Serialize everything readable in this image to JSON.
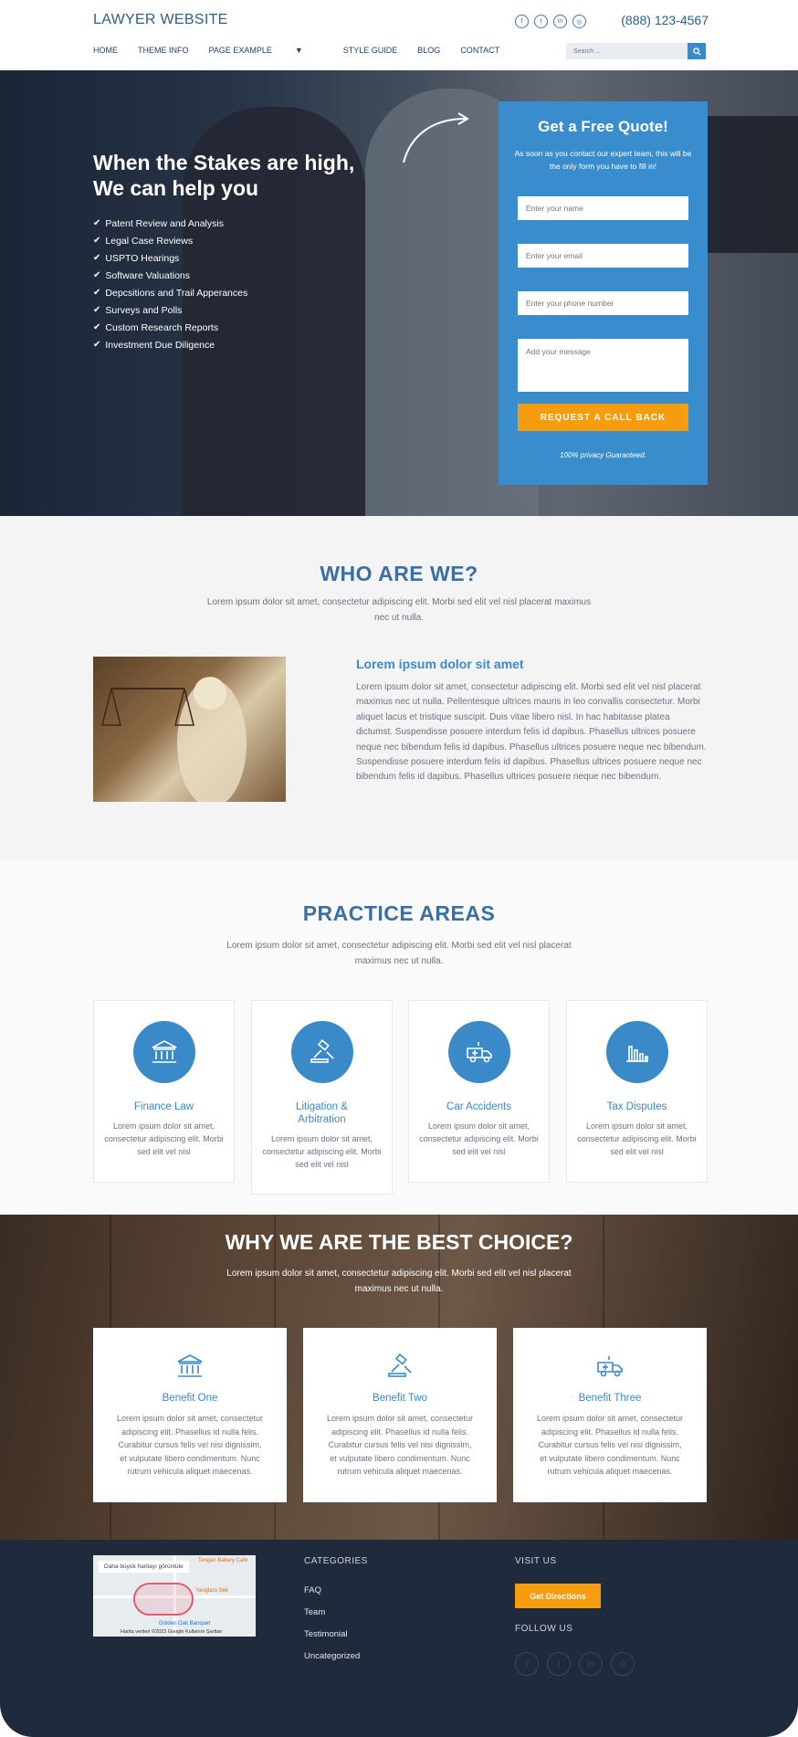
{
  "header": {
    "brand": "LAWYER WEBSITE",
    "phone": "(888) 123-4567",
    "social": [
      "facebook-icon",
      "twitter-icon",
      "linkedin-icon",
      "instagram-icon"
    ],
    "nav": [
      "HOME",
      "THEME INFO",
      "PAGE EXAMPLE",
      "STYLE GUIDE",
      "BLOG",
      "CONTACT"
    ],
    "search_placeholder": "Search ..."
  },
  "hero": {
    "title": "When the Stakes are high, We can help you",
    "list": [
      "Patent Review and Analysis",
      "Legal Case Reviews",
      "USPTO Hearings",
      "Software Valuations",
      "Depcsitions and Trail Apperances",
      "Surveys and Polls",
      "Custom Research Reports",
      "Investment Due Diligence"
    ],
    "form": {
      "title": "Get a Free Quote!",
      "subtitle": "As soon as you contact our expert team, this will be the only form you have to fill in!",
      "name_placeholder": "Enter your name",
      "email_placeholder": "Enter your email",
      "phone_placeholder": "Enter your phone number",
      "message_placeholder": "Add your message",
      "button": "REQUEST A CALL BACK",
      "privacy": "100% privacy Guaranteed."
    }
  },
  "who": {
    "title": "WHO ARE WE?",
    "subtitle": "Lorem ipsum dolor sit amet, consectetur adipiscing elit. Morbi sed elit vel nisl placerat maximus nec ut nulla.",
    "heading": "Lorem ipsum dolor sit amet",
    "body": "Lorem ipsum dolor sit amet, consectetur adipiscing elit. Morbi sed elit vel nisl placerat maximus nec ut nulla. Pellentesque ultrices mauris in leo convallis consectetur. Morbi aliquet lacus et tristique suscipit. Duis vitae libero nisl. In hac habitasse platea dictumst. Suspendisse posuere interdum felis id dapibus. Phasellus ultrices posuere neque nec bibendum felis id dapibus. Phasellus ultrices posuere neque nec bibendum. Suspendisse posuere interdum felis id dapibus. Phasellus ultrices posuere neque nec bibendum felis id dapibus. Phasellus ultrices posuere neque nec bibendum."
  },
  "practice": {
    "title": "PRACTICE AREAS",
    "subtitle": "Lorem ipsum dolor sit amet, consectetur adipiscing elit. Morbi sed elit vel nisl placerat maximus nec ut nulla.",
    "cards": [
      {
        "name": "Finance Law",
        "icon": "bank-icon",
        "desc": "Lorem ipsum dolor sit amet, consectetur adipiscing elit. Morbi sed elit vel nisl"
      },
      {
        "name": "Litigation & Arbitration",
        "icon": "gavel-icon",
        "desc": "Lorem ipsum dolor sit amet, consectetur adipiscing elit. Morbi sed elit vel nisl"
      },
      {
        "name": "Car Accidents",
        "icon": "ambulance-icon",
        "desc": "Lorem ipsum dolor sit amet, consectetur adipiscing elit. Morbi sed elit vel nisl"
      },
      {
        "name": "Tax Disputes",
        "icon": "chart-icon",
        "desc": "Lorem ipsum dolor sit amet, consectetur adipiscing elit. Morbi sed elit vel nisl"
      }
    ]
  },
  "best": {
    "title": "WHY WE ARE THE BEST CHOICE?",
    "subtitle": "Lorem ipsum dolor sit amet, consectetur adipiscing elit. Morbi sed elit vel nisl placerat maximus nec ut nulla.",
    "cards": [
      {
        "name": "Benefit One",
        "icon": "bank-icon",
        "desc": "Lorem ipsum dolor sit amet, consectetur adipiscing elit. Phasellus id nulla felis. Curabitur cursus felis vel nisi dignissim, et vulputate libero condimentum. Nunc rutrum vehicula aliquet maecenas."
      },
      {
        "name": "Benefit Two",
        "icon": "gavel-icon",
        "desc": "Lorem ipsum dolor sit amet, consectetur adipiscing elit. Phasellus id nulla felis. Curabitur cursus felis vel nisi dignissim, et vulputate libero condimentum. Nunc rutrum vehicula aliquet maecenas."
      },
      {
        "name": "Benefit Three",
        "icon": "ambulance-icon",
        "desc": "Lorem ipsum dolor sit amet, consectetur adipiscing elit. Phasellus id nulla felis. Curabitur cursus felis vel nisi dignissim, et vulputate libero condimentum. Nunc rutrum vehicula aliquet maecenas."
      }
    ]
  },
  "footer": {
    "map_label": "Daha büyük haritayı görüntüle",
    "map_places": [
      "Tengan Bakery Cafe",
      "Yangtaro Sek",
      "Golden Oak Banquet"
    ],
    "map_credit": "Harita verileri ©2023 Google   Kullanım Şartları",
    "categories_title": "CATEGORIES",
    "categories": [
      "FAQ",
      "Team",
      "Testimonial",
      "Uncategorized"
    ],
    "visit_title": "VISIT US",
    "directions_button": "Get Directions",
    "follow_title": "FOLLOW US",
    "social": [
      "facebook-icon",
      "twitter-icon",
      "linkedin-icon",
      "instagram-icon"
    ]
  },
  "colors": {
    "accent": "#3a89c9",
    "orange": "#f59d0e",
    "footer": "#1f2a3c",
    "title_blue": "#3a6fa5"
  }
}
